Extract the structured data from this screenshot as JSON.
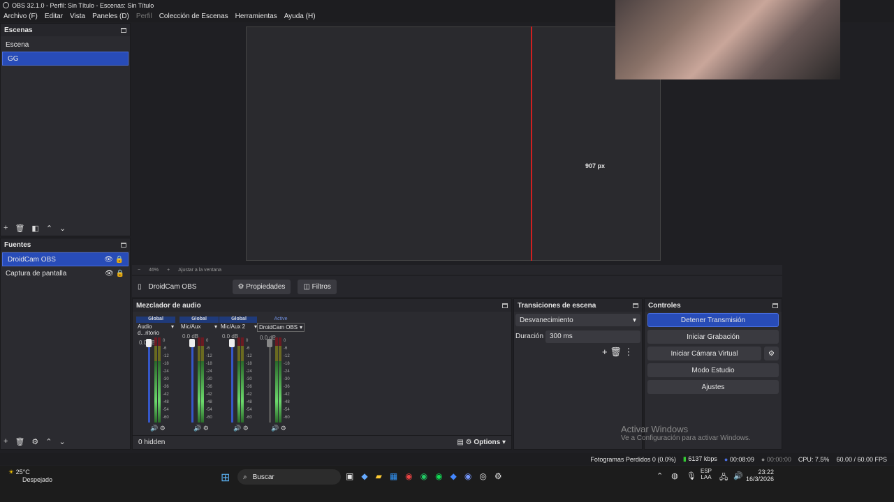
{
  "window": {
    "title": "OBS 32.1.0 - Perfil: Sin Título - Escenas: Sin Título"
  },
  "menu": [
    "Archivo (F)",
    "Editar",
    "Vista",
    "Paneles (D)",
    "Perfil",
    "Colección de Escenas",
    "Herramientas",
    "Ayuda (H)"
  ],
  "scenes": {
    "title": "Escenas",
    "items": [
      "Escena",
      "GG"
    ]
  },
  "sources": {
    "title": "Fuentes",
    "items": [
      "DroidCam OBS",
      "Captura de pantalla"
    ]
  },
  "preview": {
    "size_label": "907 px",
    "zoom": "46%",
    "fit": "Ajustar a la ventana"
  },
  "source_bar": {
    "name": "DroidCam OBS",
    "properties": "Propiedades",
    "filters": "Filtros"
  },
  "mixer": {
    "title": "Mezclador de audio",
    "strips": [
      {
        "header": "Global",
        "name": "Audio d...ritorio",
        "db": "0.0 dB"
      },
      {
        "header": "Global",
        "name": "Mic/Aux",
        "db": "0.0 dB"
      },
      {
        "header": "Global",
        "name": "Mic/Aux 2",
        "db": "0.0 dB"
      },
      {
        "header": "Active",
        "name": "DroidCam OBS",
        "db": "0.0 dB"
      }
    ],
    "ticks": [
      "0",
      "-6",
      "-12",
      "-18",
      "-24",
      "-30",
      "-36",
      "-42",
      "-48",
      "-54",
      "-60"
    ],
    "hidden": "0 hidden",
    "options": "Options"
  },
  "transitions": {
    "title": "Transiciones de escena",
    "selected": "Desvanecimiento",
    "duration_label": "Duración",
    "duration_value": "300 ms"
  },
  "controls": {
    "title": "Controles",
    "buttons": [
      "Detener Transmisión",
      "Iniciar Grabación",
      "Iniciar Cámara Virtual",
      "Modo Estudio",
      "Ajustes"
    ]
  },
  "watermark": {
    "line1": "Activar Windows",
    "line2": "Ve a Configuración para activar Windows."
  },
  "status": {
    "frames": "Fotogramas Perdidos 0 (0.0%)",
    "bitrate": "6137 kbps",
    "stream_time": "00:08:09",
    "rec_time": "00:00:00",
    "cpu": "CPU: 7.5%",
    "fps": "60.00 / 60.00 FPS"
  },
  "taskbar": {
    "weather_temp": "25°C",
    "weather_desc": "Despejado",
    "search": "Buscar",
    "lang1": "ESP",
    "lang2": "LAA",
    "time": "23:22",
    "date": "16/3/2026"
  }
}
